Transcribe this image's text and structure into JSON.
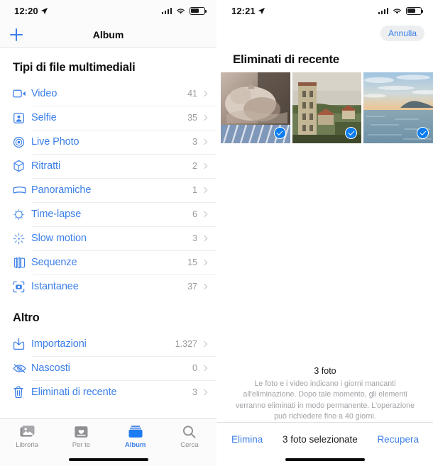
{
  "left": {
    "status": {
      "time": "12:20",
      "location_icon": "location-arrow-icon"
    },
    "navbar": {
      "title": "Album",
      "add_icon": "plus-icon"
    },
    "sections": [
      {
        "title": "Tipi di file multimediali",
        "items": [
          {
            "label": "Video",
            "count": "41",
            "icon": "video-camera-icon"
          },
          {
            "label": "Selfie",
            "count": "35",
            "icon": "selfie-icon"
          },
          {
            "label": "Live Photo",
            "count": "3",
            "icon": "live-photo-icon"
          },
          {
            "label": "Ritratti",
            "count": "2",
            "icon": "cube-icon"
          },
          {
            "label": "Panoramiche",
            "count": "1",
            "icon": "panorama-icon"
          },
          {
            "label": "Time-lapse",
            "count": "6",
            "icon": "timelapse-icon"
          },
          {
            "label": "Slow motion",
            "count": "3",
            "icon": "slow-motion-icon"
          },
          {
            "label": "Sequenze",
            "count": "15",
            "icon": "burst-icon"
          },
          {
            "label": "Istantanee",
            "count": "37",
            "icon": "screenshot-icon"
          }
        ]
      },
      {
        "title": "Altro",
        "items": [
          {
            "label": "Importazioni",
            "count": "1.327",
            "icon": "import-icon"
          },
          {
            "label": "Nascosti",
            "count": "0",
            "icon": "eye-slash-icon"
          },
          {
            "label": "Eliminati di recente",
            "count": "3",
            "icon": "trash-icon"
          }
        ]
      }
    ],
    "tabs": [
      {
        "label": "Libreria",
        "icon": "photos-library-icon",
        "active": false
      },
      {
        "label": "Per te",
        "icon": "for-you-icon",
        "active": false
      },
      {
        "label": "Album",
        "icon": "albums-icon",
        "active": true
      },
      {
        "label": "Cerca",
        "icon": "search-icon",
        "active": false
      }
    ]
  },
  "right": {
    "status": {
      "time": "12:21",
      "location_icon": "location-arrow-icon"
    },
    "cancel_label": "Annulla",
    "title": "Eliminati di recente",
    "thumbnails": [
      {
        "alt": "cat-sleeping-photo",
        "selected": true
      },
      {
        "alt": "coastal-town-photo",
        "selected": true
      },
      {
        "alt": "sea-sunset-photo",
        "selected": true
      }
    ],
    "footer": {
      "count_label": "3 foto",
      "description": "Le foto e i video indicano i giorni mancanti all'eliminazione. Dopo tale momento, gli elementi verranno eliminati in modo permanente. L'operazione può richiedere fino a 40 giorni."
    },
    "toolbar": {
      "delete_label": "Elimina",
      "status_label": "3 foto selezionate",
      "recover_label": "Recupera"
    }
  },
  "colors": {
    "accent": "#3c7fe8",
    "check": "#0a7cf0",
    "muted": "#9a9aa0"
  }
}
